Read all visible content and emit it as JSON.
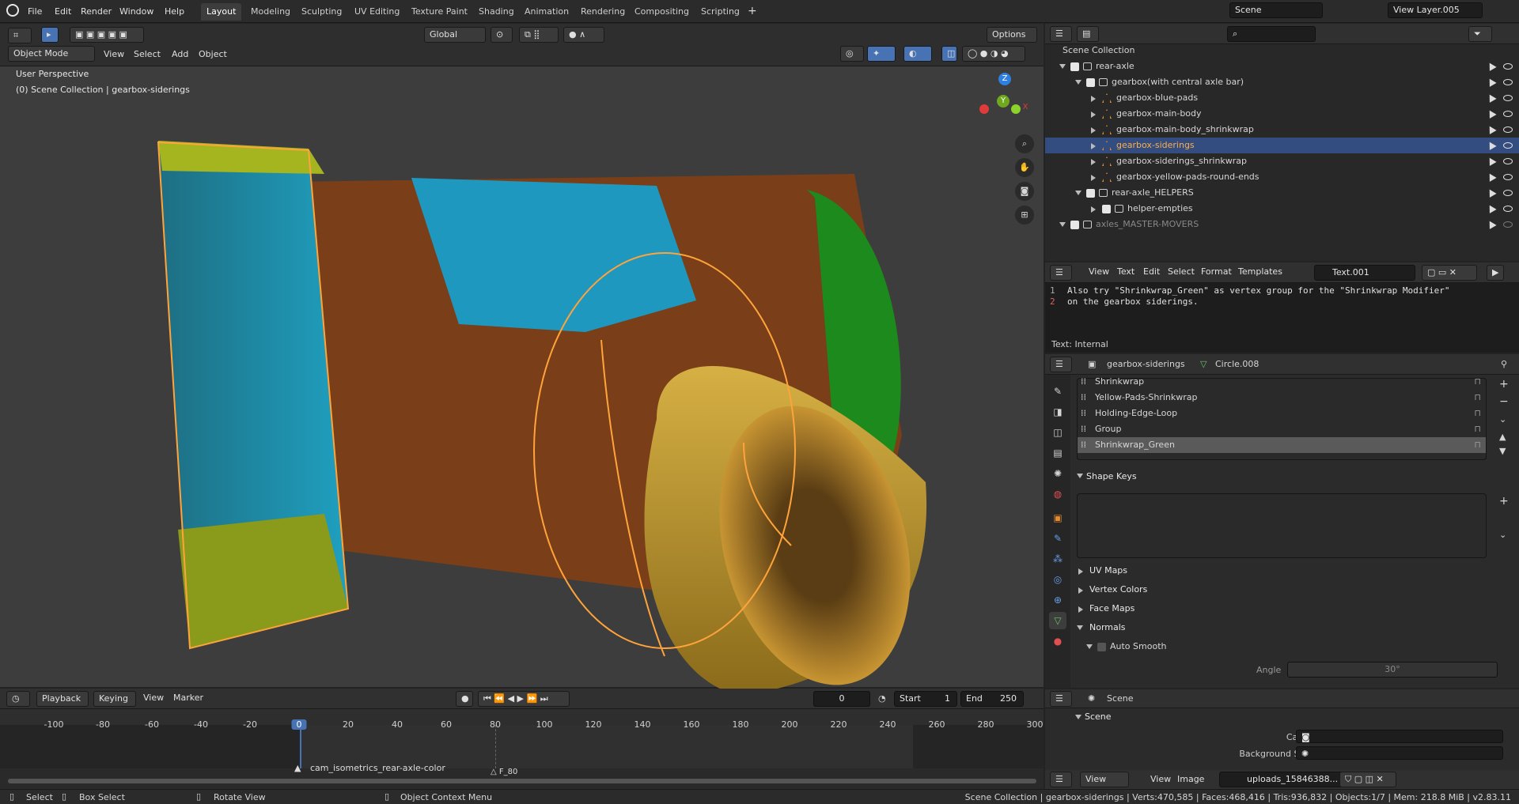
{
  "menu": {
    "file": "File",
    "edit": "Edit",
    "render": "Render",
    "window": "Window",
    "help": "Help"
  },
  "workspaces": [
    "Layout",
    "Modeling",
    "Sculpting",
    "UV Editing",
    "Texture Paint",
    "Shading",
    "Animation",
    "Rendering",
    "Compositing",
    "Scripting"
  ],
  "scene_name": "Scene",
  "view_layer": "View Layer.005",
  "viewport": {
    "mode": "Object Mode",
    "menus": [
      "View",
      "Select",
      "Add",
      "Object"
    ],
    "orientation": "Global",
    "options": "Options",
    "perspective": "User Perspective",
    "collection_info": "(0) Scene Collection | gearbox-siderings",
    "gizmo": {
      "x": "X",
      "y": "Y",
      "z": "Z"
    }
  },
  "outliner": {
    "root": "Scene Collection",
    "items": [
      {
        "label": "rear-axle",
        "depth": 0
      },
      {
        "label": "gearbox(with central axle bar)",
        "depth": 1
      },
      {
        "label": "gearbox-blue-pads",
        "depth": 2
      },
      {
        "label": "gearbox-main-body",
        "depth": 2
      },
      {
        "label": "gearbox-main-body_shrinkwrap",
        "depth": 2
      },
      {
        "label": "gearbox-siderings",
        "depth": 2,
        "selected": true
      },
      {
        "label": "gearbox-siderings_shrinkwrap",
        "depth": 2
      },
      {
        "label": "gearbox-yellow-pads-round-ends",
        "depth": 2
      },
      {
        "label": "rear-axle_HELPERS",
        "depth": 1
      },
      {
        "label": "helper-empties",
        "depth": 2
      },
      {
        "label": "axles_MASTER-MOVERS",
        "depth": 0,
        "dim": true
      }
    ]
  },
  "text_editor": {
    "menus": [
      "View",
      "Text",
      "Edit",
      "Select",
      "Format",
      "Templates"
    ],
    "file": "Text.001",
    "line1": "Also try \"Shrinkwrap_Green\" as vertex group for the \"Shrinkwrap Modifier\"",
    "line2": "on the gearbox siderings.",
    "footer": "Text: Internal",
    "ln1": "1",
    "ln2": "2"
  },
  "properties": {
    "object": "gearbox-siderings",
    "mesh": "Circle.008",
    "vertex_groups": [
      "Shrinkwrap",
      "Yellow-Pads-Shrinkwrap",
      "Holding-Edge-Loop",
      "Group",
      "Shrinkwrap_Green"
    ],
    "shape_keys": "Shape Keys",
    "uv_maps": "UV Maps",
    "vertex_colors": "Vertex Colors",
    "face_maps": "Face Maps",
    "normals": "Normals",
    "auto_smooth": "Auto Smooth",
    "angle_label": "Angle",
    "angle_value": "30°"
  },
  "scene_props": {
    "title": "Scene",
    "section": "Scene",
    "camera": "Camera",
    "background": "Background Scene"
  },
  "image_editor": {
    "menus": [
      "View",
      "View",
      "Image"
    ],
    "image": "uploads_15846388..."
  },
  "timeline": {
    "menus": [
      "Playback",
      "Keying",
      "View",
      "Marker"
    ],
    "current": "0",
    "start_label": "Start",
    "start": "1",
    "end_label": "End",
    "end": "250",
    "ticks": [
      "-100",
      "-80",
      "-60",
      "-40",
      "-20",
      "0",
      "20",
      "40",
      "60",
      "80",
      "100",
      "120",
      "140",
      "160",
      "180",
      "200",
      "220",
      "240",
      "260",
      "280",
      "300"
    ],
    "marker1": "cam_isometrics_rear-axle-color",
    "marker2": "F_80"
  },
  "statusbar": {
    "select": "Select",
    "box": "Box Select",
    "rotate": "Rotate View",
    "context": "Object Context Menu",
    "stats": "Scene Collection | gearbox-siderings | Verts:470,585 | Faces:468,416 | Tris:936,832 | Objects:1/7 | Mem: 218.8 MiB | v2.83.11"
  },
  "colors": {
    "accent": "#4772b3",
    "selected_row": "#334d80",
    "orange": "#e58b2c",
    "viewport_bg": "#3d3d3d"
  }
}
